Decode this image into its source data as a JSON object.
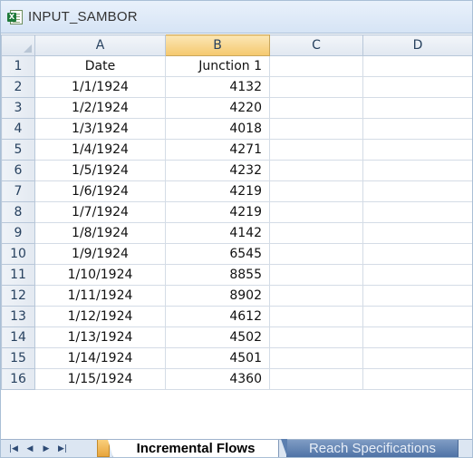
{
  "window": {
    "title": "INPUT_SAMBOR",
    "icon": "excel-workbook-icon"
  },
  "columns": [
    "A",
    "B",
    "C",
    "D"
  ],
  "selected_column": "B",
  "header_row": {
    "row": "1",
    "a": "Date",
    "b": "Junction 1"
  },
  "rows": [
    {
      "row": "2",
      "date": "1/1/1924",
      "value": "4132"
    },
    {
      "row": "3",
      "date": "1/2/1924",
      "value": "4220"
    },
    {
      "row": "4",
      "date": "1/3/1924",
      "value": "4018"
    },
    {
      "row": "5",
      "date": "1/4/1924",
      "value": "4271"
    },
    {
      "row": "6",
      "date": "1/5/1924",
      "value": "4232"
    },
    {
      "row": "7",
      "date": "1/6/1924",
      "value": "4219"
    },
    {
      "row": "8",
      "date": "1/7/1924",
      "value": "4219"
    },
    {
      "row": "9",
      "date": "1/8/1924",
      "value": "4142"
    },
    {
      "row": "10",
      "date": "1/9/1924",
      "value": "6545"
    },
    {
      "row": "11",
      "date": "1/10/1924",
      "value": "8855"
    },
    {
      "row": "12",
      "date": "1/11/1924",
      "value": "8902"
    },
    {
      "row": "13",
      "date": "1/12/1924",
      "value": "4612"
    },
    {
      "row": "14",
      "date": "1/13/1924",
      "value": "4502"
    },
    {
      "row": "15",
      "date": "1/14/1924",
      "value": "4501"
    },
    {
      "row": "16",
      "date": "1/15/1924",
      "value": "4360"
    }
  ],
  "sheet_tabs": {
    "active": "Incremental Flows",
    "inactive": "Reach Specifications"
  },
  "nav_buttons": [
    "first-sheet-icon",
    "previous-sheet-icon",
    "next-sheet-icon",
    "last-sheet-icon"
  ],
  "colors": {
    "selected_header": "#f5c86d",
    "active_tab": "#ffffff",
    "inactive_tab": "#4f73a6"
  }
}
